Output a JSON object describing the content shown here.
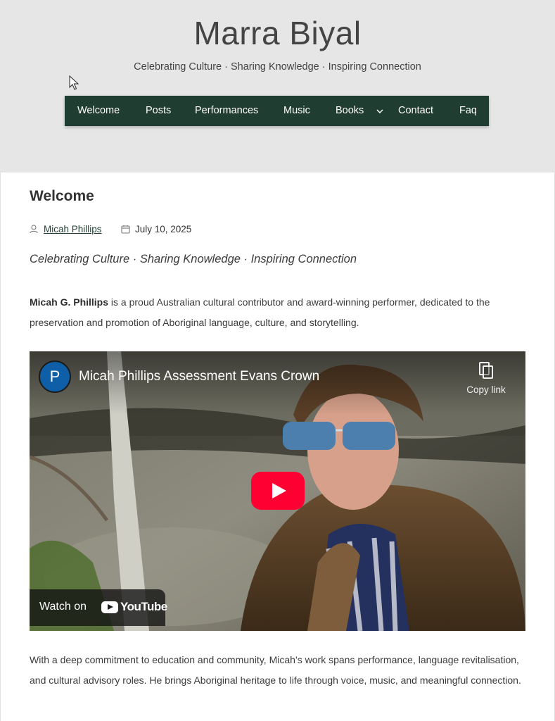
{
  "site": {
    "title": "Marra Biyal",
    "tagline": "Celebrating Culture · Sharing Knowledge · Inspiring Connection"
  },
  "nav": {
    "items": [
      {
        "label": "Welcome"
      },
      {
        "label": "Posts"
      },
      {
        "label": "Performances"
      },
      {
        "label": "Music"
      },
      {
        "label": "Books"
      },
      {
        "label": "Contact"
      },
      {
        "label": "Faq"
      }
    ]
  },
  "post": {
    "title": "Welcome",
    "author": "Micah Phillips",
    "date": "July 10, 2025",
    "lead": "Celebrating Culture · Sharing Knowledge · Inspiring Connection",
    "intro_bold": "Micah G. Phillips",
    "intro_rest": " is a proud Australian cultural contributor and award-winning performer, dedicated to the preservation and promotion of Aboriginal language, culture, and storytelling.",
    "outro": "With a deep commitment to education and community, Micah’s work spans performance, language revitalisation, and cultural advisory roles. He brings Aboriginal heritage to life through voice, music, and meaningful connection."
  },
  "video": {
    "channel_initial": "P",
    "title": "Micah Phillips Assessment Evans Crown",
    "copy_link_label": "Copy link",
    "watch_on_label": "Watch on",
    "youtube_label": "YouTube",
    "colors": {
      "play": "#ff0033",
      "avatar": "#0f5ea8"
    }
  },
  "theme": {
    "nav_bg": "#1f3d30",
    "header_bg": "#e6e6e6"
  }
}
